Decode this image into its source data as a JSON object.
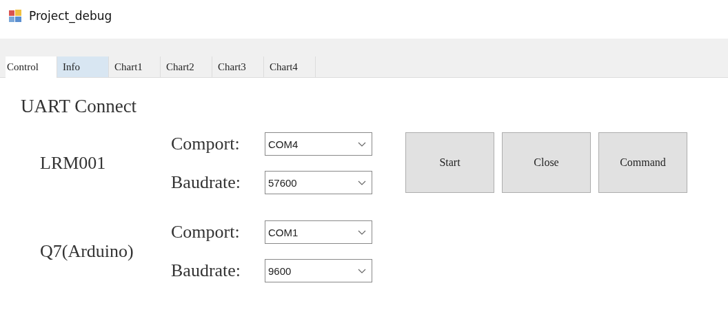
{
  "window": {
    "title": "Project_debug"
  },
  "tabs": [
    {
      "label": "Control",
      "selected": true,
      "hovered": false
    },
    {
      "label": "Info",
      "selected": false,
      "hovered": true
    },
    {
      "label": "Chart1",
      "selected": false,
      "hovered": false
    },
    {
      "label": "Chart2",
      "selected": false,
      "hovered": false
    },
    {
      "label": "Chart3",
      "selected": false,
      "hovered": false
    },
    {
      "label": "Chart4",
      "selected": false,
      "hovered": false
    }
  ],
  "section_title": "UART Connect",
  "devices": [
    {
      "name": "LRM001",
      "fields": [
        {
          "label": "Comport:",
          "value": "COM4"
        },
        {
          "label": "Baudrate:",
          "value": "57600"
        }
      ]
    },
    {
      "name": "Q7(Arduino)",
      "fields": [
        {
          "label": "Comport:",
          "value": "COM1"
        },
        {
          "label": "Baudrate:",
          "value": "9600"
        }
      ]
    }
  ],
  "buttons": [
    "Start",
    "Close",
    "Command"
  ]
}
